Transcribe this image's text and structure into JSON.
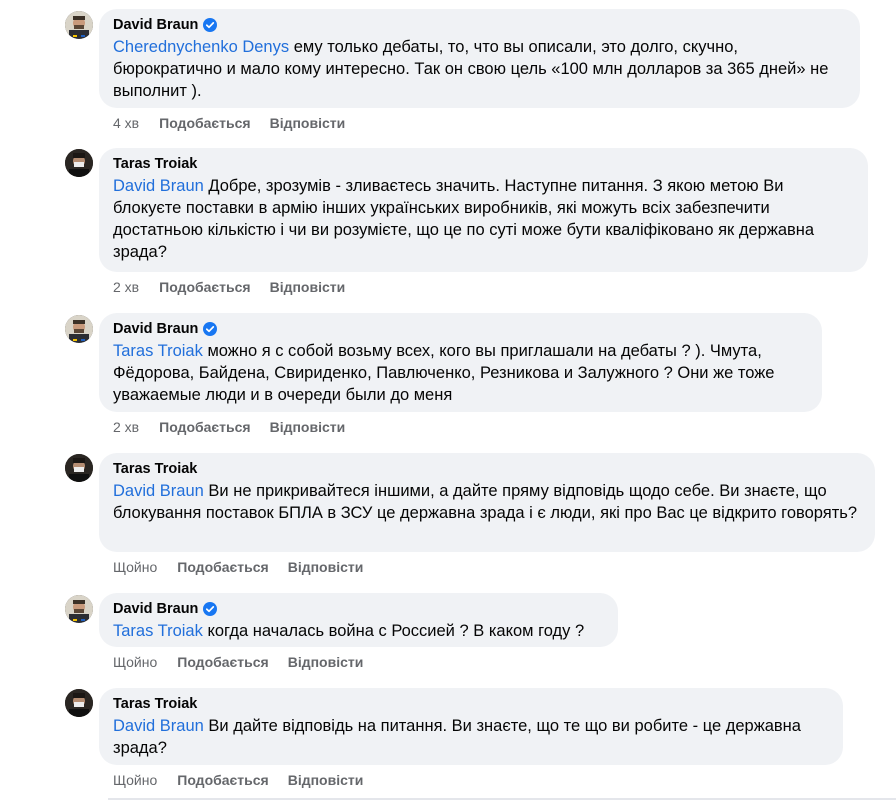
{
  "colors": {
    "bubble": "#f0f2f5",
    "mention": "#216fdb",
    "meta": "#65676b",
    "verified": "#1877f2"
  },
  "comments": [
    {
      "author": "David Braun",
      "verified": true,
      "avatar_icon": "avatar-david-icon",
      "mention": "Cherednychenko Denys",
      "text": " ему только дебаты, то, что вы описали, это долго, скучно, бюрократично и мало кому интересно. Так он свою цель «100 млн долларов за 365 дней» не выполнит ).",
      "time": "4 хв",
      "like": "Подобається",
      "reply": "Відповісти"
    },
    {
      "author": "Taras Troiak",
      "verified": false,
      "avatar_icon": "avatar-taras-icon",
      "mention": "David Braun",
      "text": " Добре, зрозумів - зливаєтесь значить. Наступне питання. З якою метою Ви блокуєте поставки в армію інших українських виробників, які можуть всіх забезпечити достатньою кількістю і чи ви розумієте, що це по суті може бути кваліфіковано як державна зрада?",
      "time": "2 хв",
      "like": "Подобається",
      "reply": "Відповісти"
    },
    {
      "author": "David Braun",
      "verified": true,
      "avatar_icon": "avatar-david-icon",
      "mention": "Taras Troiak",
      "text": " можно я с собой возьму всех, кого вы приглашали на дебаты ? ). Чмута, Фёдорова, Байдена, Свириденко, Павлюченко, Резникова и Залужного ? Они же тоже уважаемые люди и в очереди были до меня",
      "time": "2 хв",
      "like": "Подобається",
      "reply": "Відповісти"
    },
    {
      "author": "Taras Troiak",
      "verified": false,
      "avatar_icon": "avatar-taras-icon",
      "mention": "David Braun",
      "text": " Ви не прикривайтеся іншими, а дайте пряму відповідь щодо себе. Ви знаєте, що блокування поставок БПЛА в ЗСУ це державна зрада і є люди, які про Вас це відкрито говорять?",
      "time": "Щойно",
      "like": "Подобається",
      "reply": "Відповісти"
    },
    {
      "author": "David Braun",
      "verified": true,
      "avatar_icon": "avatar-david-icon",
      "mention": "Taras Troiak",
      "text": " когда началась война с Россией ? В каком году ?",
      "time": "Щойно",
      "like": "Подобається",
      "reply": "Відповісти"
    },
    {
      "author": "Taras Troiak",
      "verified": false,
      "avatar_icon": "avatar-taras-icon",
      "mention": "David Braun",
      "text": " Ви дайте відповідь на питання. Ви знаєте, що те що ви робите - це державна зрада?",
      "time": "Щойно",
      "like": "Подобається",
      "reply": "Відповісти"
    }
  ]
}
